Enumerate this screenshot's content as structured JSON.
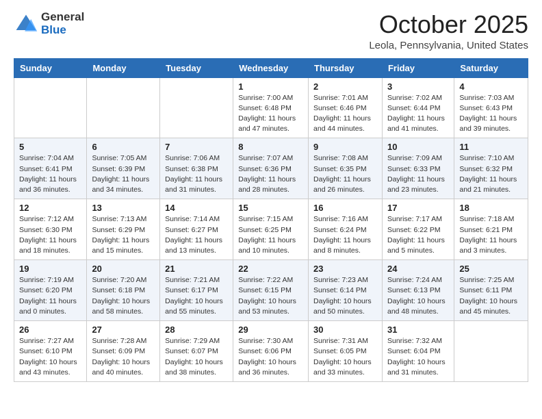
{
  "header": {
    "logo_general": "General",
    "logo_blue": "Blue",
    "title": "October 2025",
    "location": "Leola, Pennsylvania, United States"
  },
  "days_of_week": [
    "Sunday",
    "Monday",
    "Tuesday",
    "Wednesday",
    "Thursday",
    "Friday",
    "Saturday"
  ],
  "weeks": [
    [
      {
        "day": "",
        "detail": ""
      },
      {
        "day": "",
        "detail": ""
      },
      {
        "day": "",
        "detail": ""
      },
      {
        "day": "1",
        "detail": "Sunrise: 7:00 AM\nSunset: 6:48 PM\nDaylight: 11 hours\nand 47 minutes."
      },
      {
        "day": "2",
        "detail": "Sunrise: 7:01 AM\nSunset: 6:46 PM\nDaylight: 11 hours\nand 44 minutes."
      },
      {
        "day": "3",
        "detail": "Sunrise: 7:02 AM\nSunset: 6:44 PM\nDaylight: 11 hours\nand 41 minutes."
      },
      {
        "day": "4",
        "detail": "Sunrise: 7:03 AM\nSunset: 6:43 PM\nDaylight: 11 hours\nand 39 minutes."
      }
    ],
    [
      {
        "day": "5",
        "detail": "Sunrise: 7:04 AM\nSunset: 6:41 PM\nDaylight: 11 hours\nand 36 minutes."
      },
      {
        "day": "6",
        "detail": "Sunrise: 7:05 AM\nSunset: 6:39 PM\nDaylight: 11 hours\nand 34 minutes."
      },
      {
        "day": "7",
        "detail": "Sunrise: 7:06 AM\nSunset: 6:38 PM\nDaylight: 11 hours\nand 31 minutes."
      },
      {
        "day": "8",
        "detail": "Sunrise: 7:07 AM\nSunset: 6:36 PM\nDaylight: 11 hours\nand 28 minutes."
      },
      {
        "day": "9",
        "detail": "Sunrise: 7:08 AM\nSunset: 6:35 PM\nDaylight: 11 hours\nand 26 minutes."
      },
      {
        "day": "10",
        "detail": "Sunrise: 7:09 AM\nSunset: 6:33 PM\nDaylight: 11 hours\nand 23 minutes."
      },
      {
        "day": "11",
        "detail": "Sunrise: 7:10 AM\nSunset: 6:32 PM\nDaylight: 11 hours\nand 21 minutes."
      }
    ],
    [
      {
        "day": "12",
        "detail": "Sunrise: 7:12 AM\nSunset: 6:30 PM\nDaylight: 11 hours\nand 18 minutes."
      },
      {
        "day": "13",
        "detail": "Sunrise: 7:13 AM\nSunset: 6:29 PM\nDaylight: 11 hours\nand 15 minutes."
      },
      {
        "day": "14",
        "detail": "Sunrise: 7:14 AM\nSunset: 6:27 PM\nDaylight: 11 hours\nand 13 minutes."
      },
      {
        "day": "15",
        "detail": "Sunrise: 7:15 AM\nSunset: 6:25 PM\nDaylight: 11 hours\nand 10 minutes."
      },
      {
        "day": "16",
        "detail": "Sunrise: 7:16 AM\nSunset: 6:24 PM\nDaylight: 11 hours\nand 8 minutes."
      },
      {
        "day": "17",
        "detail": "Sunrise: 7:17 AM\nSunset: 6:22 PM\nDaylight: 11 hours\nand 5 minutes."
      },
      {
        "day": "18",
        "detail": "Sunrise: 7:18 AM\nSunset: 6:21 PM\nDaylight: 11 hours\nand 3 minutes."
      }
    ],
    [
      {
        "day": "19",
        "detail": "Sunrise: 7:19 AM\nSunset: 6:20 PM\nDaylight: 11 hours\nand 0 minutes."
      },
      {
        "day": "20",
        "detail": "Sunrise: 7:20 AM\nSunset: 6:18 PM\nDaylight: 10 hours\nand 58 minutes."
      },
      {
        "day": "21",
        "detail": "Sunrise: 7:21 AM\nSunset: 6:17 PM\nDaylight: 10 hours\nand 55 minutes."
      },
      {
        "day": "22",
        "detail": "Sunrise: 7:22 AM\nSunset: 6:15 PM\nDaylight: 10 hours\nand 53 minutes."
      },
      {
        "day": "23",
        "detail": "Sunrise: 7:23 AM\nSunset: 6:14 PM\nDaylight: 10 hours\nand 50 minutes."
      },
      {
        "day": "24",
        "detail": "Sunrise: 7:24 AM\nSunset: 6:13 PM\nDaylight: 10 hours\nand 48 minutes."
      },
      {
        "day": "25",
        "detail": "Sunrise: 7:25 AM\nSunset: 6:11 PM\nDaylight: 10 hours\nand 45 minutes."
      }
    ],
    [
      {
        "day": "26",
        "detail": "Sunrise: 7:27 AM\nSunset: 6:10 PM\nDaylight: 10 hours\nand 43 minutes."
      },
      {
        "day": "27",
        "detail": "Sunrise: 7:28 AM\nSunset: 6:09 PM\nDaylight: 10 hours\nand 40 minutes."
      },
      {
        "day": "28",
        "detail": "Sunrise: 7:29 AM\nSunset: 6:07 PM\nDaylight: 10 hours\nand 38 minutes."
      },
      {
        "day": "29",
        "detail": "Sunrise: 7:30 AM\nSunset: 6:06 PM\nDaylight: 10 hours\nand 36 minutes."
      },
      {
        "day": "30",
        "detail": "Sunrise: 7:31 AM\nSunset: 6:05 PM\nDaylight: 10 hours\nand 33 minutes."
      },
      {
        "day": "31",
        "detail": "Sunrise: 7:32 AM\nSunset: 6:04 PM\nDaylight: 10 hours\nand 31 minutes."
      },
      {
        "day": "",
        "detail": ""
      }
    ]
  ]
}
